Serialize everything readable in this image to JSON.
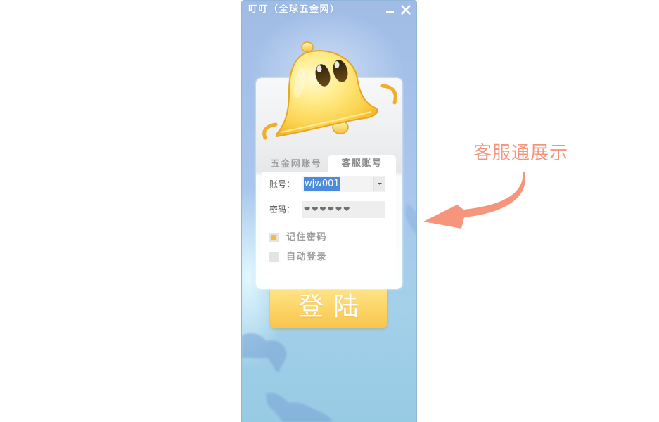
{
  "window": {
    "title": "叮叮（全球五金网）",
    "minimize_icon": "minimize-icon",
    "close_icon": "close-icon"
  },
  "mascot": {
    "icon": "bell-mascot-logo"
  },
  "tabs": [
    {
      "label": "五金网账号",
      "active": false
    },
    {
      "label": "客服账号",
      "active": true
    }
  ],
  "form": {
    "account": {
      "label": "账号：",
      "value": "wjw001",
      "selected": true,
      "dropdown_icon": "chevron-down-icon"
    },
    "password": {
      "label": "密码：",
      "masked_value": "❤❤❤❤❤❤"
    }
  },
  "options": [
    {
      "label": "记住密码",
      "checked": true
    },
    {
      "label": "自动登录",
      "checked": false
    }
  ],
  "login_button": {
    "label": "登陆"
  },
  "annotation": {
    "text": "客服通展示",
    "arrow_icon": "curved-arrow-icon"
  },
  "colors": {
    "annotation": "#f7957c",
    "selection": "#4a8bdc",
    "check": "#f6b840",
    "button_top": "#ffe58c",
    "button_bottom": "#f8c44e",
    "window_top": "#a0bce6",
    "window_bottom": "#97cbe3"
  }
}
